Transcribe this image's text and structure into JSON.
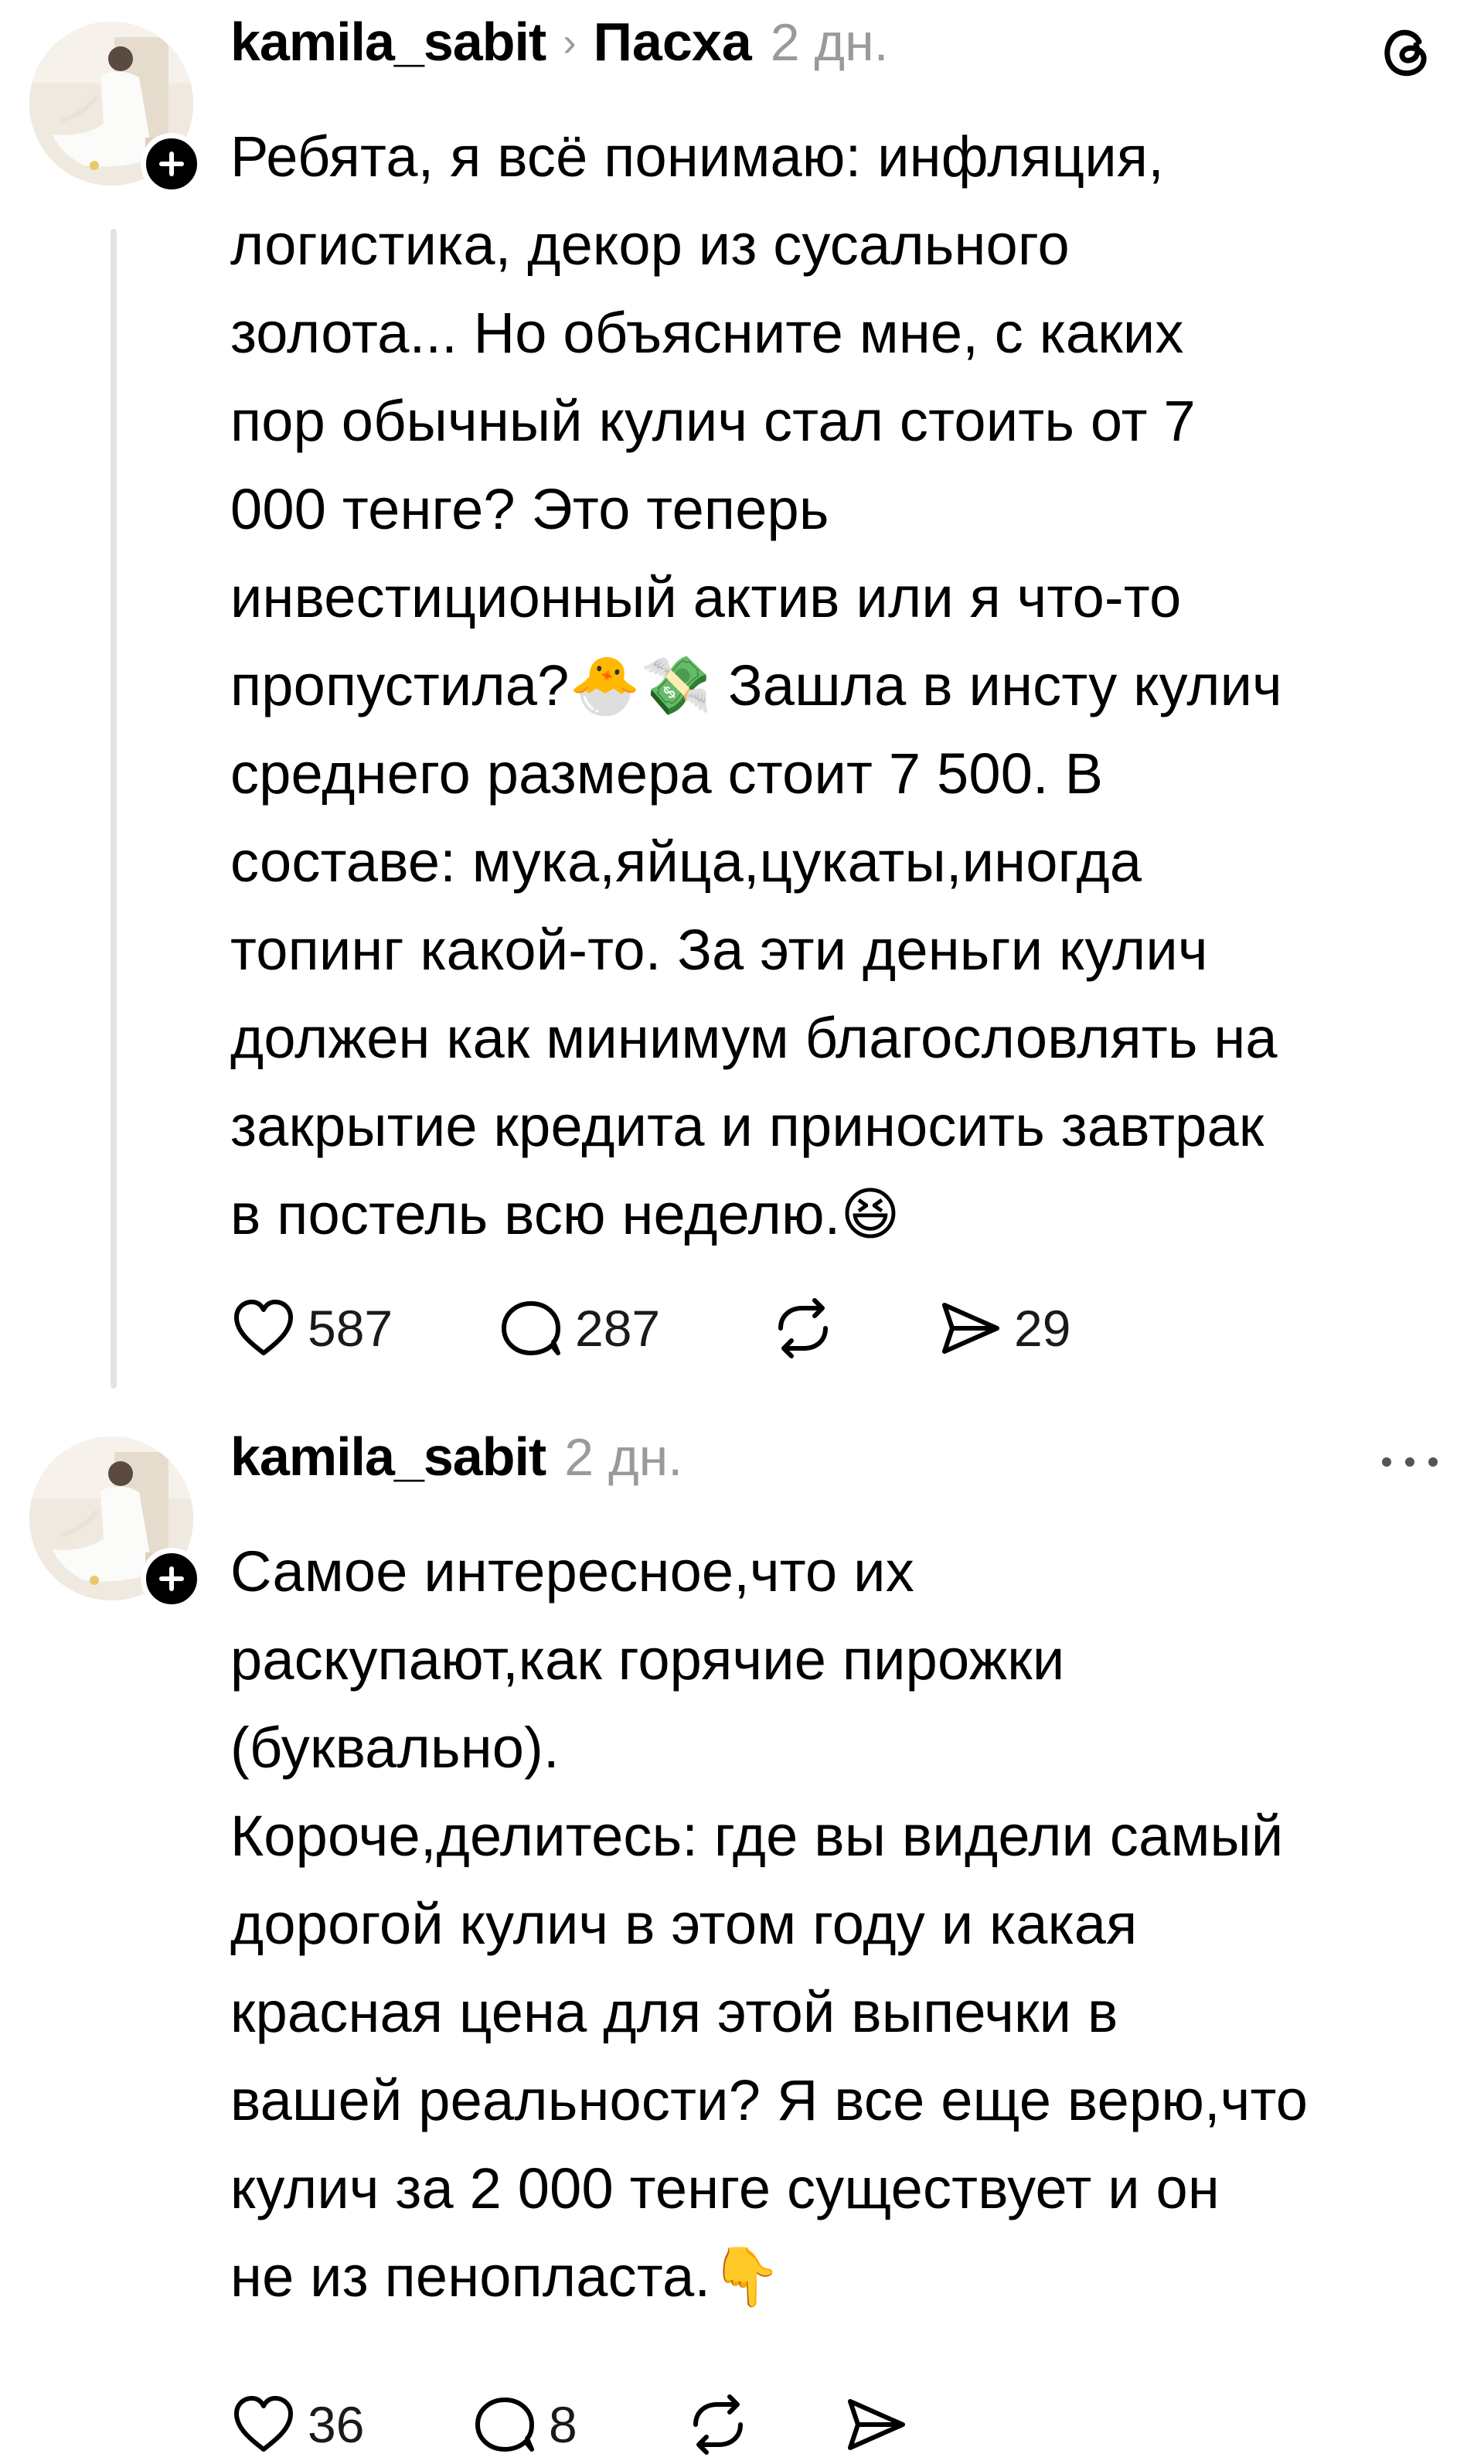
{
  "posts": [
    {
      "username": "kamila_sabit",
      "topic": "Пасха",
      "time": "2 дн.",
      "avatar_icon": "avatar-photo",
      "follow_icon": "plus-icon",
      "corner_icon": "threads-logo",
      "paragraphs": [
        {
          "lines": [
            "Ребята, я всё понимаю: инфляция,",
            "логистика, декор из сусального",
            "золота... Но объясните мне, с каких",
            "пор обычный кулич стал стоить от 7",
            "000 тенге? Это теперь",
            "инвестиционный актив или я что-то",
            "пропустила?🐣💸 Зашла в инсту кулич",
            "среднего размера стоит 7 500. В",
            "составе: мука,яйца,цукаты,иногда",
            "топинг какой-то. За эти деньги кулич",
            "должен как минимум благословлять на",
            "закрытие кредита и приносить завтрак",
            "в постель всю неделю.😆"
          ]
        }
      ],
      "likes": "587",
      "comments": "287",
      "shares": "29"
    },
    {
      "username": "kamila_sabit",
      "time": "2 дн.",
      "avatar_icon": "avatar-photo",
      "follow_icon": "plus-icon",
      "corner_icon": "more-icon",
      "paragraphs": [
        {
          "lines": [
            "Самое интересное,что их",
            "раскупают,как горячие пирожки",
            "(буквально)."
          ]
        },
        {
          "lines": [
            "Короче,делитесь: где вы видели самый",
            "дорогой кулич в этом году и какая",
            "красная цена для этой выпечки в",
            "вашей реальности? Я все еще верю,что",
            "кулич за 2 000 тенге существует и он",
            "не из пенопласта.👇"
          ]
        }
      ],
      "likes": "36",
      "comments": "8",
      "shares": ""
    }
  ],
  "colors": {
    "text": "#000000",
    "muted": "#9a9a9a",
    "thread_line": "#e3e3e3",
    "background": "#ffffff"
  }
}
